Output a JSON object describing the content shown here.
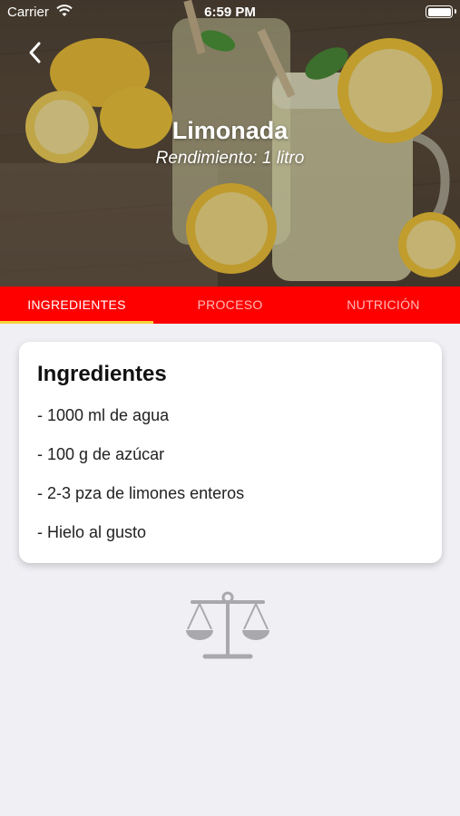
{
  "status_bar": {
    "carrier": "Carrier",
    "time": "6:59 PM"
  },
  "header": {
    "back_icon": "chevron-left-icon",
    "title": "Limonada",
    "subtitle": "Rendimiento: 1 litro"
  },
  "tabs": [
    {
      "label": "INGREDIENTES",
      "active": true
    },
    {
      "label": "PROCESO",
      "active": false
    },
    {
      "label": "NUTRICIÓN",
      "active": false
    }
  ],
  "card": {
    "title": "Ingredientes",
    "items": [
      "- 1000 ml de agua",
      "- 100 g de azúcar",
      "- 2-3 pza de limones enteros",
      "- Hielo al gusto"
    ]
  },
  "footer_icon": "scale-icon",
  "colors": {
    "tab_bar": "#ff0000",
    "tab_indicator": "#f5d33c",
    "background": "#efeff4",
    "icon_gray": "#a9a9ad"
  }
}
